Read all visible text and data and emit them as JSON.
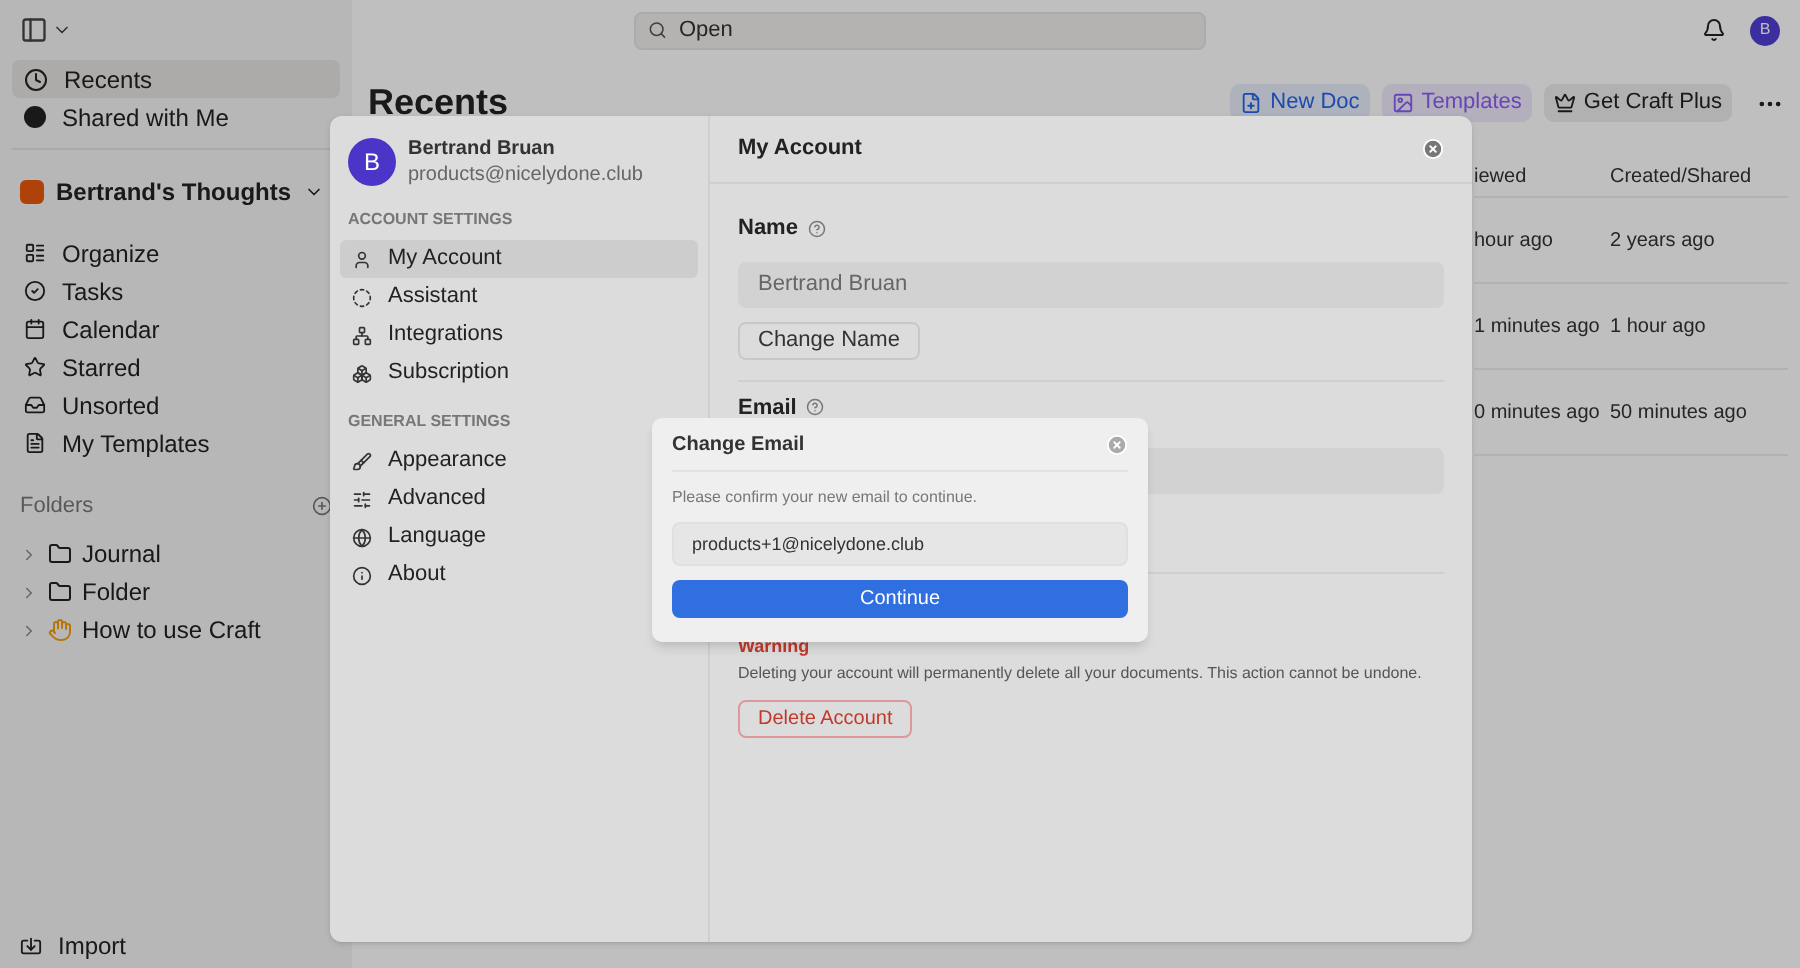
{
  "topbar": {
    "search": {
      "placeholder": "Open"
    },
    "avatar": "B"
  },
  "sidebar": {
    "nav": [
      {
        "label": "Recents",
        "selected": true
      },
      {
        "label": "Shared with Me",
        "selected": false
      }
    ],
    "workspace": "Bertrand's Thoughts",
    "items": [
      {
        "label": "Organize",
        "selected": false
      },
      {
        "label": "Tasks",
        "selected": false
      },
      {
        "label": "Calendar",
        "selected": false
      },
      {
        "label": "Starred",
        "selected": false
      },
      {
        "label": "Unsorted",
        "selected": false
      },
      {
        "label": "My Templates",
        "selected": false
      }
    ],
    "folders_heading": "Folders",
    "folders": [
      {
        "label": "Journal",
        "kind": "folder"
      },
      {
        "label": "Folder",
        "kind": "folder"
      },
      {
        "label": "How to use Craft",
        "kind": "emoji"
      }
    ],
    "import": "Import"
  },
  "main": {
    "title": "Recents",
    "actions": [
      {
        "label": "New Doc",
        "kind": "new"
      },
      {
        "label": "Templates",
        "kind": "templates"
      },
      {
        "label": "Get Craft Plus",
        "kind": "plus"
      }
    ],
    "table": {
      "columns": [
        "iewed",
        "Created/Shared"
      ],
      "rows": [
        {
          "column_1": "hour ago",
          "column_2": "2 years ago"
        },
        {
          "column_1": "1 minutes ago",
          "column_2": "1 hour ago"
        },
        {
          "column_1": "0 minutes ago",
          "column_2": "50 minutes ago"
        }
      ]
    }
  },
  "settings": {
    "user": {
      "initial": "B",
      "name": "Bertrand Bruan",
      "email": "products@nicelydone.club"
    },
    "sections": [
      {
        "heading": "ACCOUNT SETTINGS",
        "items": [
          {
            "label": "My Account",
            "selected": true
          },
          {
            "label": "Assistant",
            "selected": false
          },
          {
            "label": "Integrations",
            "selected": false
          },
          {
            "label": "Subscription",
            "selected": false
          }
        ]
      },
      {
        "heading": "GENERAL SETTINGS",
        "items": [
          {
            "label": "Appearance",
            "selected": false
          },
          {
            "label": "Advanced",
            "selected": false
          },
          {
            "label": "Language",
            "selected": false
          },
          {
            "label": "About",
            "selected": false
          }
        ]
      }
    ],
    "title": "My Account",
    "name_label": "Name",
    "name_value": "Bertrand Bruan",
    "change_name": "Change Name",
    "email_label": "Email",
    "warning": "Warning",
    "warning_text": "Deleting your account will permanently delete all your documents. This action cannot be undone.",
    "delete_button": "Delete Account"
  },
  "dialog": {
    "title": "Change Email",
    "message": "Please confirm your new email to continue.",
    "value": "products+1@nicelydone.club",
    "button": "Continue"
  }
}
